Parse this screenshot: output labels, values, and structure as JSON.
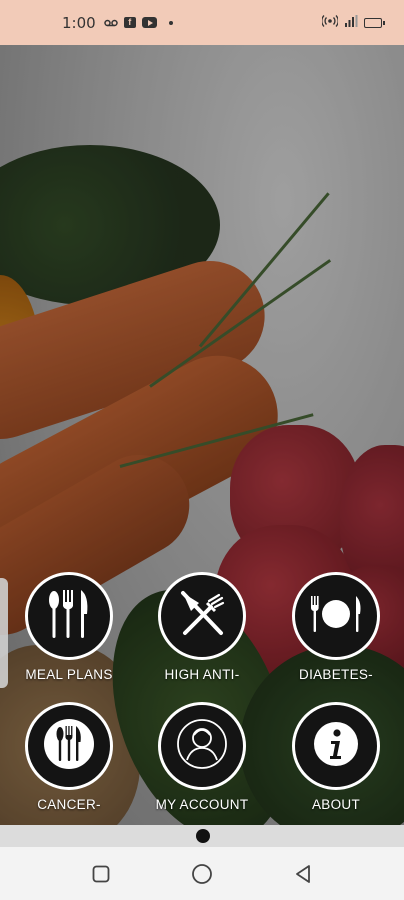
{
  "status_bar": {
    "time": "1:00",
    "icons": [
      "voicemail-icon",
      "facebook-icon",
      "youtube-icon",
      "dot-icon"
    ],
    "right_icons": [
      "hotspot-icon",
      "signal-icon",
      "battery-icon"
    ]
  },
  "menu": {
    "items": [
      {
        "label": "MEAL PLANS",
        "icon": "utensils-icon"
      },
      {
        "label": "HIGH ANTI-",
        "icon": "crossed-knife-fork-icon"
      },
      {
        "label": "DIABETES-",
        "icon": "plate-fork-knife-icon"
      },
      {
        "label": "CANCER-",
        "icon": "fork-knife-spoon-icon"
      },
      {
        "label": "MY ACCOUNT",
        "icon": "user-account-icon"
      },
      {
        "label": "ABOUT",
        "icon": "info-icon"
      }
    ]
  },
  "pager": {
    "active_index": 0,
    "count": 1
  },
  "colors": {
    "status_bar": "#f2cbb8",
    "circle_bg": "#141414",
    "circle_border": "#ffffff"
  }
}
